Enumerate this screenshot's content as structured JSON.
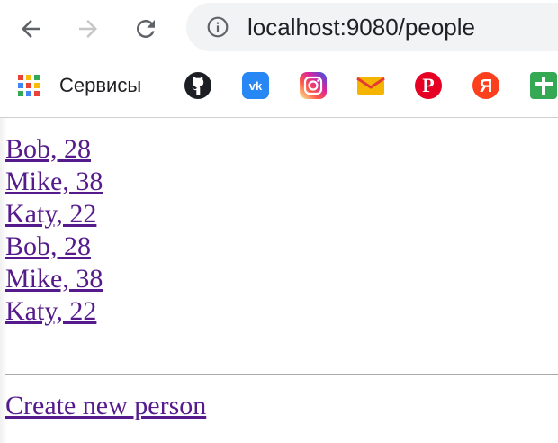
{
  "browser": {
    "url": "localhost:9080/people",
    "bookmarks": {
      "apps_label": "Сервисы",
      "items": [
        {
          "name": "github",
          "color": "#1b1f23"
        },
        {
          "name": "vk",
          "color": "#2787f5"
        },
        {
          "name": "instagram",
          "color": "#d6249f"
        },
        {
          "name": "mail",
          "color": "#f5b400"
        },
        {
          "name": "pinterest",
          "color": "#e60023"
        },
        {
          "name": "yandex",
          "color": "#fc3f1d"
        },
        {
          "name": "plus",
          "color": "#34a853"
        }
      ]
    }
  },
  "page": {
    "people": [
      {
        "label": "Bob, 28"
      },
      {
        "label": "Mike, 38"
      },
      {
        "label": "Katy, 22"
      },
      {
        "label": "Bob, 28"
      },
      {
        "label": "Mike, 38"
      },
      {
        "label": "Katy, 22"
      }
    ],
    "create_link": "Create new person",
    "link_color": "#551a8b"
  }
}
